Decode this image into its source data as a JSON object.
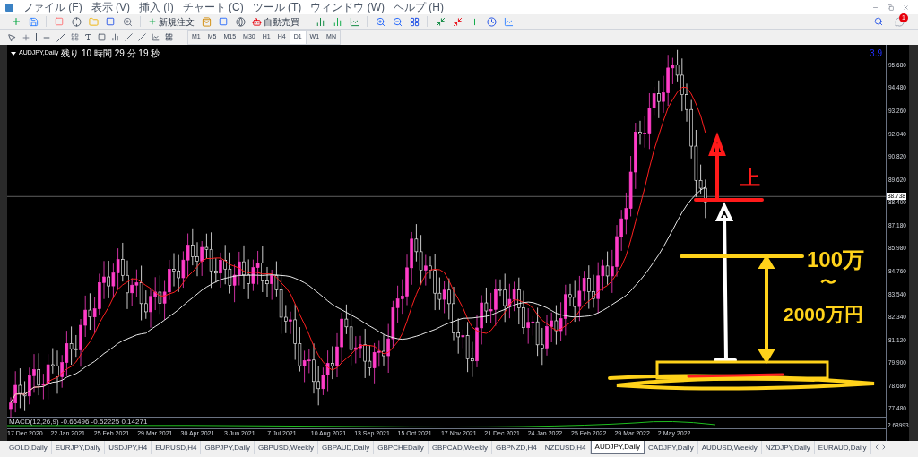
{
  "menu": [
    "ファイル (F)",
    "表示 (V)",
    "挿入 (I)",
    "チャート (C)",
    "ツール (T)",
    "ウィンドウ (W)",
    "ヘルプ (H)"
  ],
  "toolbar": {
    "new_order": "新規注文",
    "auto_trading": "自動売買"
  },
  "timeframes": [
    {
      "label": "M1",
      "selected": false
    },
    {
      "label": "M5",
      "selected": false
    },
    {
      "label": "M15",
      "selected": false
    },
    {
      "label": "M30",
      "selected": false
    },
    {
      "label": "H1",
      "selected": false
    },
    {
      "label": "H4",
      "selected": false
    },
    {
      "label": "D1",
      "selected": true
    },
    {
      "label": "W1",
      "selected": false
    },
    {
      "label": "MN",
      "selected": false
    }
  ],
  "notifications": {
    "badge": "1"
  },
  "chart": {
    "symbol": "AUDJPY,Daily",
    "countdown": "残り 10 時間 29 分 19 秒",
    "corner_value": "3.9",
    "price_axis": [
      "95.680",
      "94.480",
      "93.260",
      "92.040",
      "90.820",
      "89.620",
      "88.400",
      "87.180",
      "85.980",
      "84.760",
      "83.540",
      "82.340",
      "81.120",
      "79.900",
      "78.680",
      "77.480"
    ],
    "current_price": "88.738",
    "macd": {
      "label": "MACD(12,26,9) -0.66496 -0.52225 0.14271",
      "axis": "2.68993"
    },
    "date_axis": [
      "17 Dec 2020",
      "22 Jan 2021",
      "25 Feb 2021",
      "29 Mar 2021",
      "30 Apr 2021",
      "3 Jun 2021",
      "7 Jul 2021",
      "10 Aug 2021",
      "13 Sep 2021",
      "15 Oct 2021",
      "17 Nov 2021",
      "21 Dec 2021",
      "24 Jan 2022",
      "25 Feb 2022",
      "29 Mar 2022",
      "2 May 2022"
    ],
    "annotations": [
      {
        "text": "上",
        "color": "#ff1a1a"
      },
      {
        "text": "100万",
        "color": "#ffd21a"
      },
      {
        "text": "〜",
        "color": "#ffd21a"
      },
      {
        "text": "2000万円",
        "color": "#ffd21a"
      }
    ]
  },
  "tabs": [
    {
      "label": "GOLD,Daily",
      "selected": false
    },
    {
      "label": "EURJPY,Daily",
      "selected": false
    },
    {
      "label": "USDJPY,H4",
      "selected": false
    },
    {
      "label": "EURUSD,H4",
      "selected": false
    },
    {
      "label": "GBPJPY,Daily",
      "selected": false
    },
    {
      "label": "GBPUSD,Weekly",
      "selected": false
    },
    {
      "label": "GBPAUD,Daily",
      "selected": false
    },
    {
      "label": "GBPCHEDaily",
      "selected": false
    },
    {
      "label": "GBPCAD,Weekly",
      "selected": false
    },
    {
      "label": "GBPNZD,H4",
      "selected": false
    },
    {
      "label": "NZDUSD,H4",
      "selected": false
    },
    {
      "label": "AUDJPY,Daily",
      "selected": true
    },
    {
      "label": "CADJPY,Daily",
      "selected": false
    },
    {
      "label": "AUDUSD,Weekly",
      "selected": false
    },
    {
      "label": "NZDJPY,Daily",
      "selected": false
    },
    {
      "label": "EURAUD,Daily",
      "selected": false
    }
  ]
}
